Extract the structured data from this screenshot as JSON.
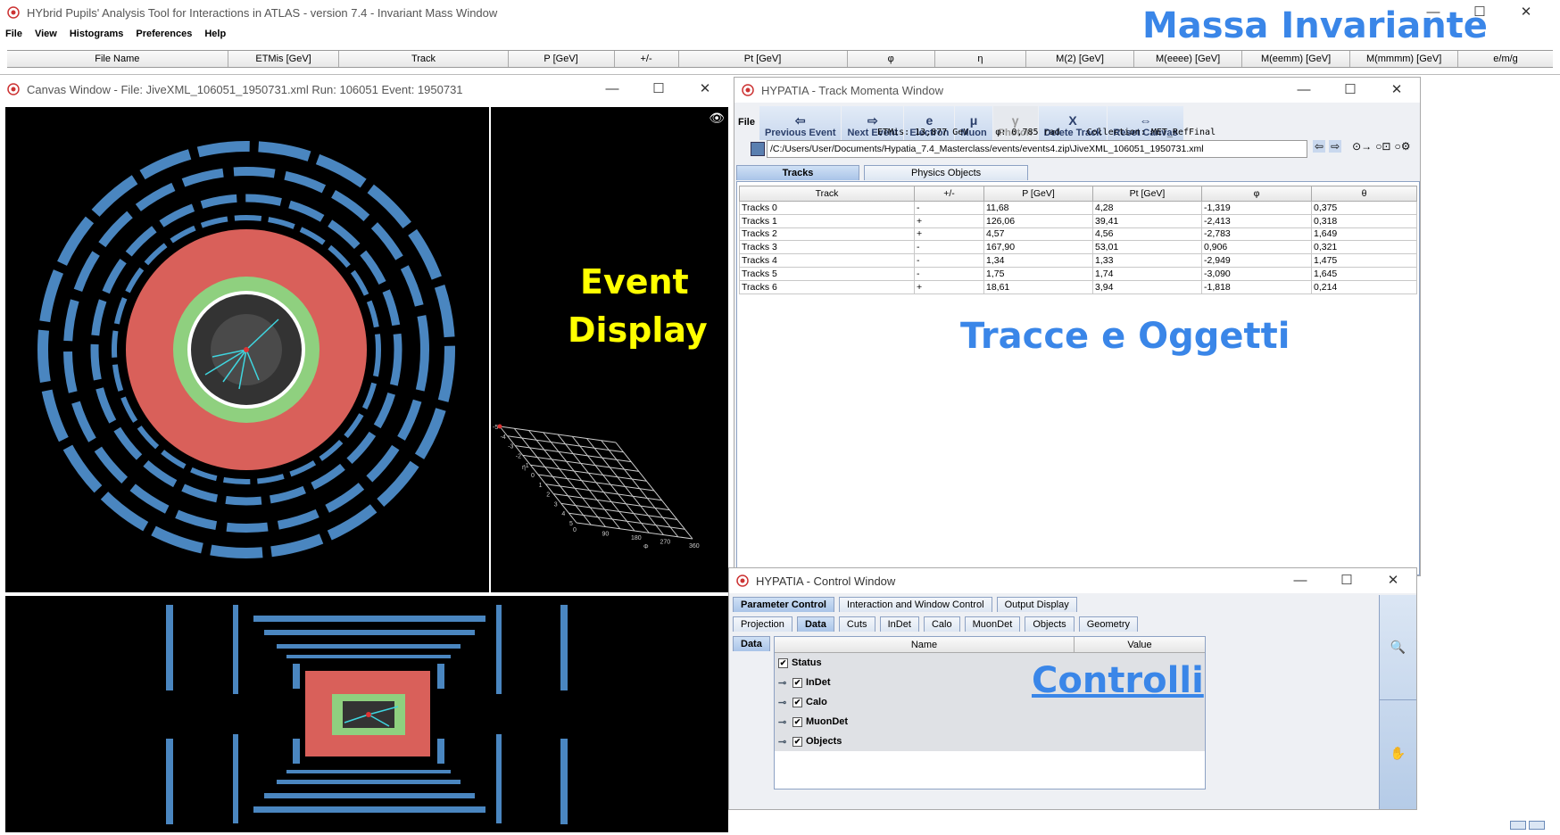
{
  "main": {
    "title": "HYbrid Pupils' Analysis Tool for Interactions in ATLAS - version 7.4 - Invariant Mass Window",
    "menu": [
      "File",
      "View",
      "Histograms",
      "Preferences",
      "Help"
    ],
    "columns": [
      "File Name",
      "ETMis [GeV]",
      "Track",
      "P [GeV]",
      "+/-",
      "Pt [GeV]",
      "φ",
      "η",
      "M(2) [GeV]",
      "M(eeee) [GeV]",
      "M(eemm) [GeV]",
      "M(mmmm) [GeV]",
      "e/m/g"
    ],
    "overlay_label": "Massa Invariante"
  },
  "canvas": {
    "title": "Canvas Window -  File: JiveXML_106051_1950731.xml  Run: 106051  Event: 1950731",
    "overlay_label_line1": "Event",
    "overlay_label_line2": "Display",
    "lego_y_ticks": [
      "-5",
      "-4",
      "-3",
      "-2",
      "-1",
      "0",
      "1",
      "2",
      "3",
      "4",
      "5"
    ],
    "lego_x_ticks": [
      "0",
      "90",
      "180",
      "270",
      "360"
    ],
    "lego_x_label": "Φ",
    "lego_y_label": "η"
  },
  "tracks_window": {
    "title": "HYPATIA - Track Momenta Window",
    "file_menu": "File",
    "toolbar": [
      {
        "label": "Previous Event",
        "icon": "⇦"
      },
      {
        "label": "Next Event",
        "icon": "⇨"
      },
      {
        "label": "Electron",
        "icon": "e"
      },
      {
        "label": "Muon",
        "icon": "μ"
      },
      {
        "label": "Photon",
        "icon": "γ"
      },
      {
        "label": "Delete Track",
        "icon": "X"
      },
      {
        "label": "Reset Canvas",
        "icon": "⇔"
      }
    ],
    "etmis": "ETMis: 13,877 GeV",
    "phi": "φ: 0,785 rad",
    "collection": "Collection: MET_RefFinal",
    "path": "/C:/Users/User/Documents/Hypatia_7.4_Masterclass/events/events4.zip\\JiveXML_106051_1950731.xml",
    "tabs": [
      "Tracks",
      "Physics Objects"
    ],
    "table_headers": [
      "Track",
      "+/-",
      "P [GeV]",
      "Pt [GeV]",
      "φ",
      "θ"
    ],
    "rows": [
      [
        "Tracks 0",
        "-",
        "11,68",
        "4,28",
        "-1,319",
        "0,375"
      ],
      [
        "Tracks 1",
        "+",
        "126,06",
        "39,41",
        "-2,413",
        "0,318"
      ],
      [
        "Tracks 2",
        "+",
        "4,57",
        "4,56",
        "-2,783",
        "1,649"
      ],
      [
        "Tracks 3",
        "-",
        "167,90",
        "53,01",
        "0,906",
        "0,321"
      ],
      [
        "Tracks 4",
        "-",
        "1,34",
        "1,33",
        "-2,949",
        "1,475"
      ],
      [
        "Tracks 5",
        "-",
        "1,75",
        "1,74",
        "-3,090",
        "1,645"
      ],
      [
        "Tracks 6",
        "+",
        "18,61",
        "3,94",
        "-1,818",
        "0,214"
      ]
    ],
    "overlay_label": "Tracce e Oggetti"
  },
  "control_window": {
    "title": "HYPATIA - Control Window",
    "tabs_top": [
      "Parameter Control",
      "Interaction and Window Control",
      "Output Display"
    ],
    "tabs_sub": [
      "Projection",
      "Data",
      "Cuts",
      "InDet",
      "Calo",
      "MuonDet",
      "Objects",
      "Geometry"
    ],
    "side_tab": "Data",
    "col_name": "Name",
    "col_value": "Value",
    "tree": [
      "Status",
      "InDet",
      "Calo",
      "MuonDet",
      "Objects"
    ],
    "overlay_label": "Controlli"
  },
  "colors": {
    "accent_blue": "#3a86e8",
    "label_yellow": "#ffff00",
    "calo_red": "#d9605a",
    "calo_green": "#8fd07f",
    "muon_blue": "#4a86c0",
    "track_cyan": "#3fd6e0"
  }
}
